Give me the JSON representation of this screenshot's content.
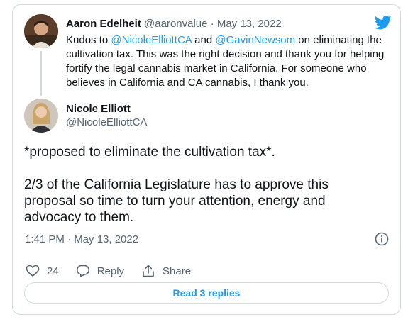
{
  "colors": {
    "accent": "#1d9bf0",
    "muted": "#536471",
    "border": "#cfd9de",
    "text": "#0f1419"
  },
  "reply_tweet": {
    "author_name": "Aaron Edelheit",
    "author_handle": "@aaronvalue",
    "date": "· May 13, 2022",
    "text_1": "Kudos to ",
    "mention_1": "@NicoleElliottCA",
    "text_2": " and ",
    "mention_2": "@GavinNewsom",
    "text_3": " on eliminating the cultivation tax. This was the right decision and thank you for helping fortify the legal cannabis market in California. For someone who believes in California and CA cannabis, I thank you."
  },
  "main_tweet": {
    "author_name": "Nicole Elliott",
    "author_handle": "@NicoleElliottCA",
    "paragraph_1": "*proposed to eliminate the cultivation tax*.",
    "paragraph_2": "2/3 of the California Legislature has to approve this proposal so time to turn your attention, energy and advocacy to them.",
    "timestamp": "1:41 PM · May 13, 2022"
  },
  "actions": {
    "like_count": "24",
    "reply_label": "Reply",
    "share_label": "Share"
  },
  "read_replies_label": "Read 3 replies",
  "icons": [
    "twitter-logo-icon",
    "info-icon",
    "heart-icon",
    "reply-bubble-icon",
    "share-icon"
  ]
}
